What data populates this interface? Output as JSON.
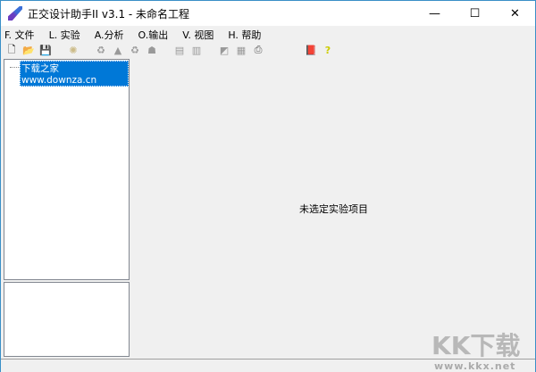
{
  "window": {
    "title": "正交设计助手II v3.1 - 未命名工程",
    "minimize": "—",
    "maximize": "☐",
    "close": "✕"
  },
  "menu": [
    "F. 文件",
    "L. 实验",
    "A.分析",
    "O.输出",
    "V. 视图",
    "H. 帮助"
  ],
  "toolbar": [
    {
      "icon": "new-file-icon",
      "glyph": "🗋"
    },
    {
      "icon": "open-folder-icon",
      "glyph": "📂"
    },
    {
      "icon": "save-icon",
      "glyph": "💾"
    },
    {
      "icon": "wizard-icon",
      "glyph": "✺"
    },
    {
      "icon": "recycle-icon",
      "glyph": "♻"
    },
    {
      "icon": "warning-icon",
      "glyph": "▲"
    },
    {
      "icon": "recycle-2-icon",
      "glyph": "♻"
    },
    {
      "icon": "people-icon",
      "glyph": "☗"
    },
    {
      "icon": "doc-icon",
      "glyph": "▤"
    },
    {
      "icon": "doc-2-icon",
      "glyph": "▥"
    },
    {
      "icon": "chart-icon",
      "glyph": "◩"
    },
    {
      "icon": "report-icon",
      "glyph": "▦"
    },
    {
      "icon": "print-icon",
      "glyph": "⎙"
    },
    {
      "icon": "book-icon",
      "glyph": "📕"
    },
    {
      "icon": "help-icon",
      "glyph": "?"
    }
  ],
  "tree": {
    "root": "下载之家www.downza.cn"
  },
  "main": {
    "message": "未选定实验项目"
  },
  "watermark": {
    "logo": "KK下载",
    "url": "www.kkx.net"
  }
}
